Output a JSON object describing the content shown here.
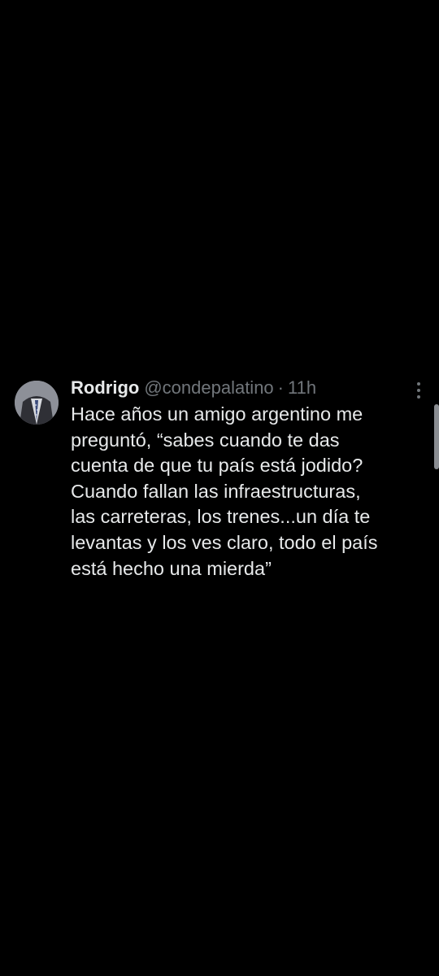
{
  "tweet": {
    "author_name": "Rodrigo",
    "handle": "@condepalatino",
    "separator": "·",
    "time": "11h",
    "text_lines": [
      "Hace años un amigo argentino me",
      "preguntó, “sabes cuando te das",
      "cuenta de que tu país está jodido?",
      "Cuando fallan las infraestructuras,",
      "las carreteras, los trenes...un día te",
      "levantas y los ves claro, todo el país",
      "está hecho una mierda”"
    ]
  },
  "icons": {
    "more": "more-options-icon",
    "avatar": "profile-avatar"
  },
  "colors": {
    "background": "#000000",
    "primary_text": "#e7e9ea",
    "secondary_text": "#71767b"
  }
}
